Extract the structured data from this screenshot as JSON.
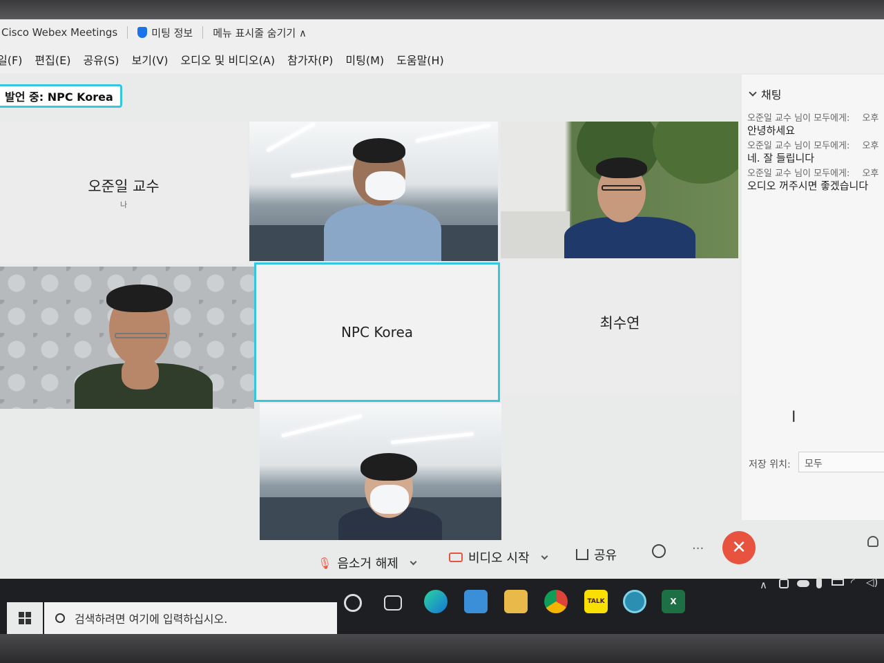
{
  "titlebar": {
    "app_title": "Cisco Webex Meetings",
    "meeting_info": "미팅 정보",
    "hide_menu": "메뉴 표시줄 숨기기 ∧"
  },
  "menubar": {
    "items": [
      "일(F)",
      "편집(E)",
      "공유(S)",
      "보기(V)",
      "오디오 및 비디오(A)",
      "참가자(P)",
      "미팅(M)",
      "도움말(H)"
    ]
  },
  "speaking": {
    "label": "발언 중: NPC Korea"
  },
  "participants": {
    "me": {
      "name": "오준일 교수",
      "sub": "나"
    },
    "npc": {
      "name": "NPC Korea"
    },
    "choi": {
      "name": "최수연"
    }
  },
  "chat": {
    "header": "채팅",
    "messages": [
      {
        "meta": "오준일 교수 님이 모두에게:",
        "meta_tail": "오후",
        "text": "안녕하세요"
      },
      {
        "meta": "오준일 교수 님이 모두에게:",
        "meta_tail": "오후",
        "text": "네. 잘 들립니다"
      },
      {
        "meta": "오준일 교수 님이 모두에게:",
        "meta_tail": "오후",
        "text": "오디오 꺼주시면 좋겠습니다"
      }
    ],
    "save_to_label": "저장 위치:",
    "save_to_value": "모두"
  },
  "controls": {
    "unmute": "음소거 해제",
    "start_video": "비디오 시작",
    "share": "공유",
    "more": "···",
    "leave": "✕"
  },
  "taskbar": {
    "search_placeholder": "검색하려면 여기에 입력하십시오.",
    "kakao_label": "TALK",
    "excel_label": "X"
  },
  "colors": {
    "active_border": "#35c6e0",
    "leave_red": "#e8533f",
    "taskbar": "#1e1f22"
  }
}
